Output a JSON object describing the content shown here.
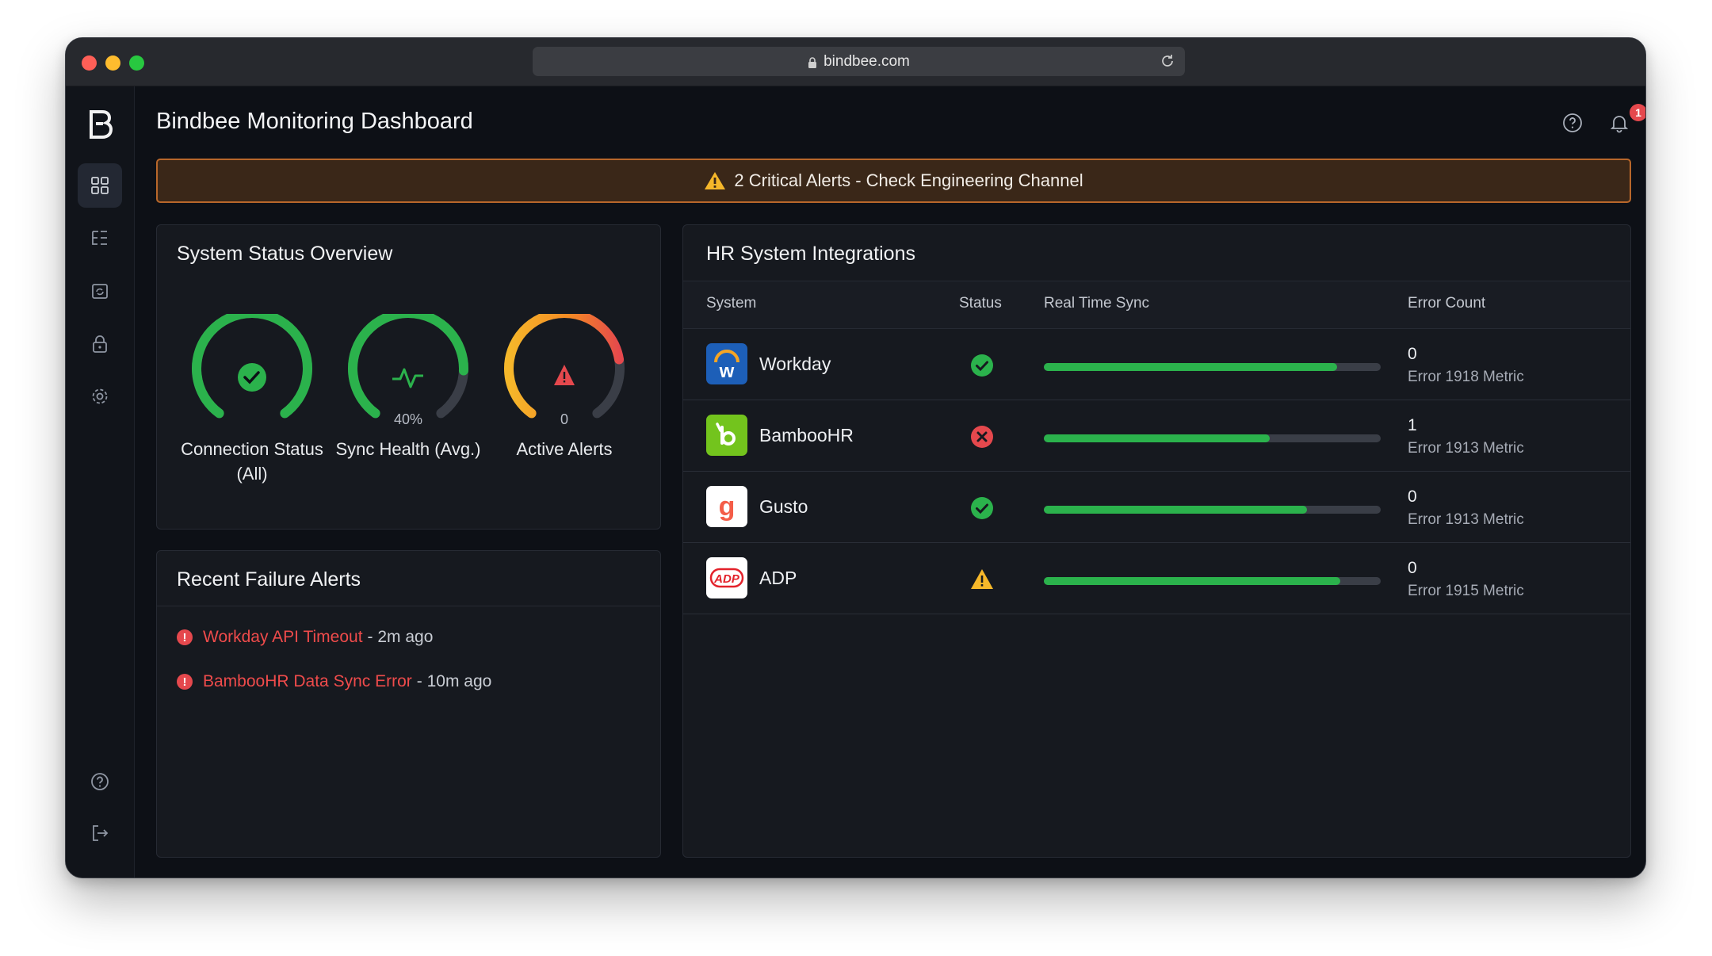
{
  "browser": {
    "url": "bindbee.com"
  },
  "header": {
    "title": "Bindbee Monitoring Dashboard",
    "notification_count": "1",
    "avatar_initial": "B"
  },
  "banner": {
    "text": "2 Critical Alerts - Check Engineering Channel"
  },
  "sidebar": {
    "items": [
      {
        "icon": "grid-icon",
        "active": true
      },
      {
        "icon": "hierarchy-icon",
        "active": false
      },
      {
        "icon": "sync-box-icon",
        "active": false
      },
      {
        "icon": "lock-icon",
        "active": false
      },
      {
        "icon": "gear-icon",
        "active": false
      }
    ],
    "bottom": [
      {
        "icon": "help-icon"
      },
      {
        "icon": "logout-icon"
      }
    ]
  },
  "status_overview": {
    "title": "System Status Overview",
    "gauges": [
      {
        "label": "Connection Status (All)",
        "value": "",
        "level": 1.0,
        "color": "#2bb24c",
        "icon": "check-icon"
      },
      {
        "label": "Sync Health (Avg.)",
        "value": "40%",
        "level": 0.82,
        "color": "#2bb24c",
        "icon": "pulse-icon"
      },
      {
        "label": "Active Alerts",
        "value": "0",
        "level": 0.78,
        "color": "#f5a524",
        "icon": "alert-bell-icon"
      }
    ]
  },
  "failures": {
    "title": "Recent Failure Alerts",
    "items": [
      {
        "link": "Workday API Timeout",
        "time": "- 2m ago"
      },
      {
        "link": "BambooHR Data Sync Error",
        "time": "- 10m ago"
      }
    ]
  },
  "integrations": {
    "title": "HR System Integrations",
    "columns": [
      "System",
      "Status",
      "Real Time Sync",
      "Error Count"
    ],
    "rows": [
      {
        "system": "Workday",
        "status": "ok",
        "sync": 0.87,
        "count": "0",
        "sub": "Error 1918 Metric",
        "logo": "workday-logo"
      },
      {
        "system": "BambooHR",
        "status": "error",
        "sync": 0.67,
        "count": "1",
        "sub": "Error 1913 Metric",
        "logo": "bamboohr-logo"
      },
      {
        "system": "Gusto",
        "status": "ok",
        "sync": 0.78,
        "count": "0",
        "sub": "Error 1913 Metric",
        "logo": "gusto-logo"
      },
      {
        "system": "ADP",
        "status": "warning",
        "sync": 0.88,
        "count": "0",
        "sub": "Error 1915 Metric",
        "logo": "adp-logo"
      }
    ]
  },
  "colors": {
    "ok": "#2bb24c",
    "error": "#e5484d",
    "warning": "#f5b72a",
    "banner_border": "#b8672b"
  }
}
